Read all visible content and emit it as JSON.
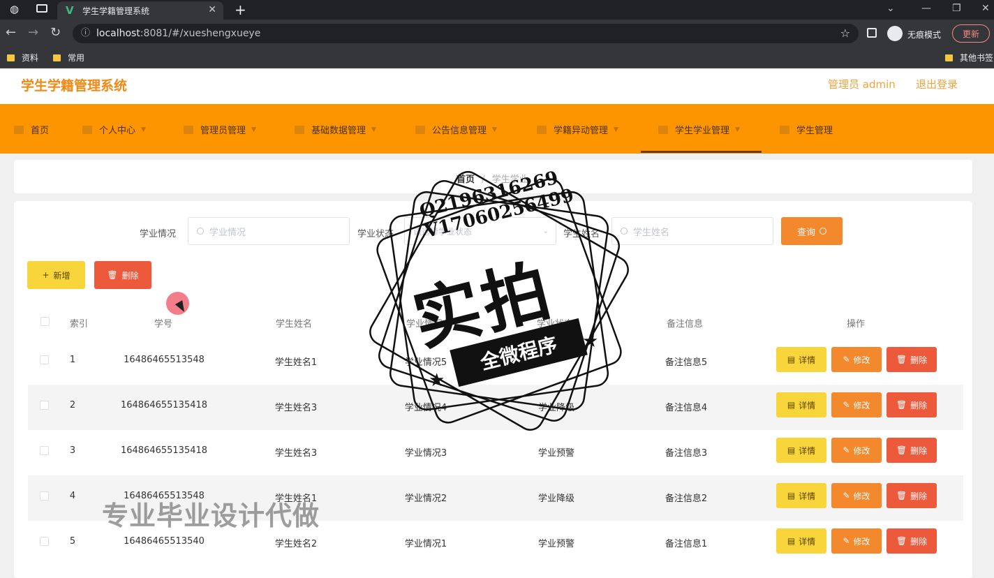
{
  "browser": {
    "tab_title": "学生学籍管理系统",
    "url_host": "localhost",
    "url_rest": ":8081/#/xueshengxueye",
    "incognito_label": "无痕模式",
    "update_label": "更新",
    "bookmarks": [
      "资料",
      "常用"
    ],
    "other_bookmarks": "其他书签"
  },
  "app": {
    "title": "学生学籍管理系统",
    "admin_label": "管理员 admin",
    "logout_label": "退出登录"
  },
  "menu": {
    "items": [
      "首页",
      "个人中心",
      "管理员管理",
      "基础数据管理",
      "公告信息管理",
      "学籍异动管理",
      "学生学业管理",
      "学生管理"
    ],
    "active_index": 6
  },
  "breadcrumb": {
    "home": "首页",
    "separator": "/",
    "current": "学生学业"
  },
  "search": {
    "fields": [
      {
        "label": "学业情况",
        "placeholder": "学业情况"
      },
      {
        "label": "学业状态",
        "placeholder": "请选择学业状态"
      },
      {
        "label": "学生姓名",
        "placeholder": "学生姓名"
      }
    ],
    "query_label": "查询"
  },
  "actions": {
    "add_label": "新增",
    "delete_label": "删除"
  },
  "table": {
    "columns": [
      "索引",
      "学号",
      "学生姓名",
      "学业情况",
      "学业状态",
      "备注信息",
      "操作"
    ],
    "rows": [
      {
        "index": "1",
        "no": "16486465513548",
        "name": "学生姓名1",
        "situation": "学业情况5",
        "status": "",
        "remark": "备注信息5"
      },
      {
        "index": "2",
        "no": "164864655135418",
        "name": "学生姓名3",
        "situation": "学业情况4",
        "status": "学业降级",
        "remark": "备注信息4"
      },
      {
        "index": "3",
        "no": "164864655135418",
        "name": "学生姓名3",
        "situation": "学业情况3",
        "status": "学业预警",
        "remark": "备注信息3"
      },
      {
        "index": "4",
        "no": "16486465513548",
        "name": "学生姓名1",
        "situation": "学业情况2",
        "status": "学业降级",
        "remark": "备注信息2"
      },
      {
        "index": "5",
        "no": "16486465513540",
        "name": "学生姓名2",
        "situation": "学业情况1",
        "status": "学业预警",
        "remark": "备注信息1"
      }
    ],
    "row_buttons": {
      "detail": "详情",
      "edit": "修改",
      "delete": "删除"
    }
  },
  "overlay": {
    "stamp_qq": "Q2196316269",
    "stamp_wx": "V17060256499",
    "stamp_big": "实拍",
    "stamp_ribbon": "全微程序",
    "watermark": "专业毕业设计代做"
  },
  "colors": {
    "menu_bg": "#fd9500",
    "accent": "#f08a14",
    "detail_btn": "#f8d53a",
    "edit_btn": "#f4882c",
    "delete_btn": "#ec5a3b"
  }
}
